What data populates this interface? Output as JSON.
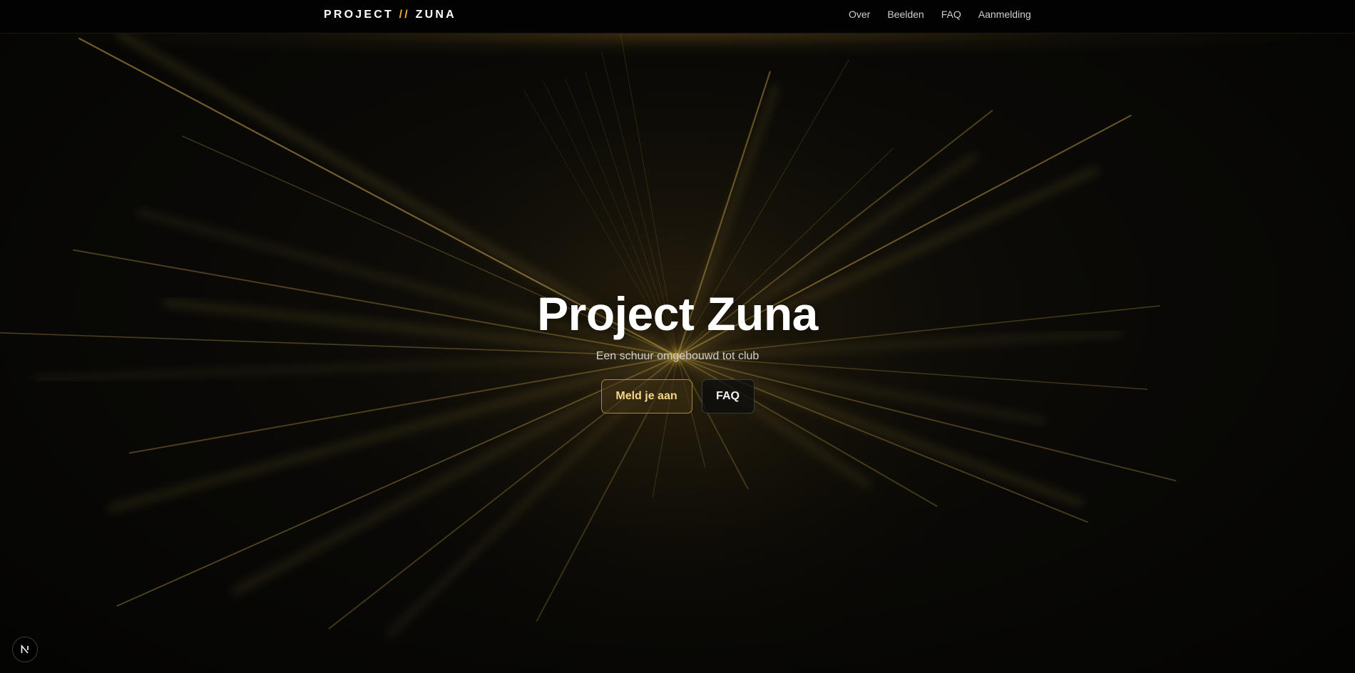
{
  "brand": {
    "prefix": "PROJECT",
    "separator": "//",
    "suffix": "ZUNA",
    "accent_color": "#e8b23a"
  },
  "nav": {
    "items": [
      {
        "label": "Over"
      },
      {
        "label": "Beelden"
      },
      {
        "label": "FAQ"
      },
      {
        "label": "Aanmelding"
      }
    ]
  },
  "hero": {
    "title": "Project Zuna",
    "subtitle": "Een schuur omgebouwd tot club",
    "primary_button": "Meld je aan",
    "secondary_button": "FAQ"
  },
  "colors": {
    "background": "#050403",
    "gold": "#c9a24a",
    "button_text_gold": "#f4d78a"
  },
  "badge": {
    "icon": "nextjs-logo-icon"
  }
}
